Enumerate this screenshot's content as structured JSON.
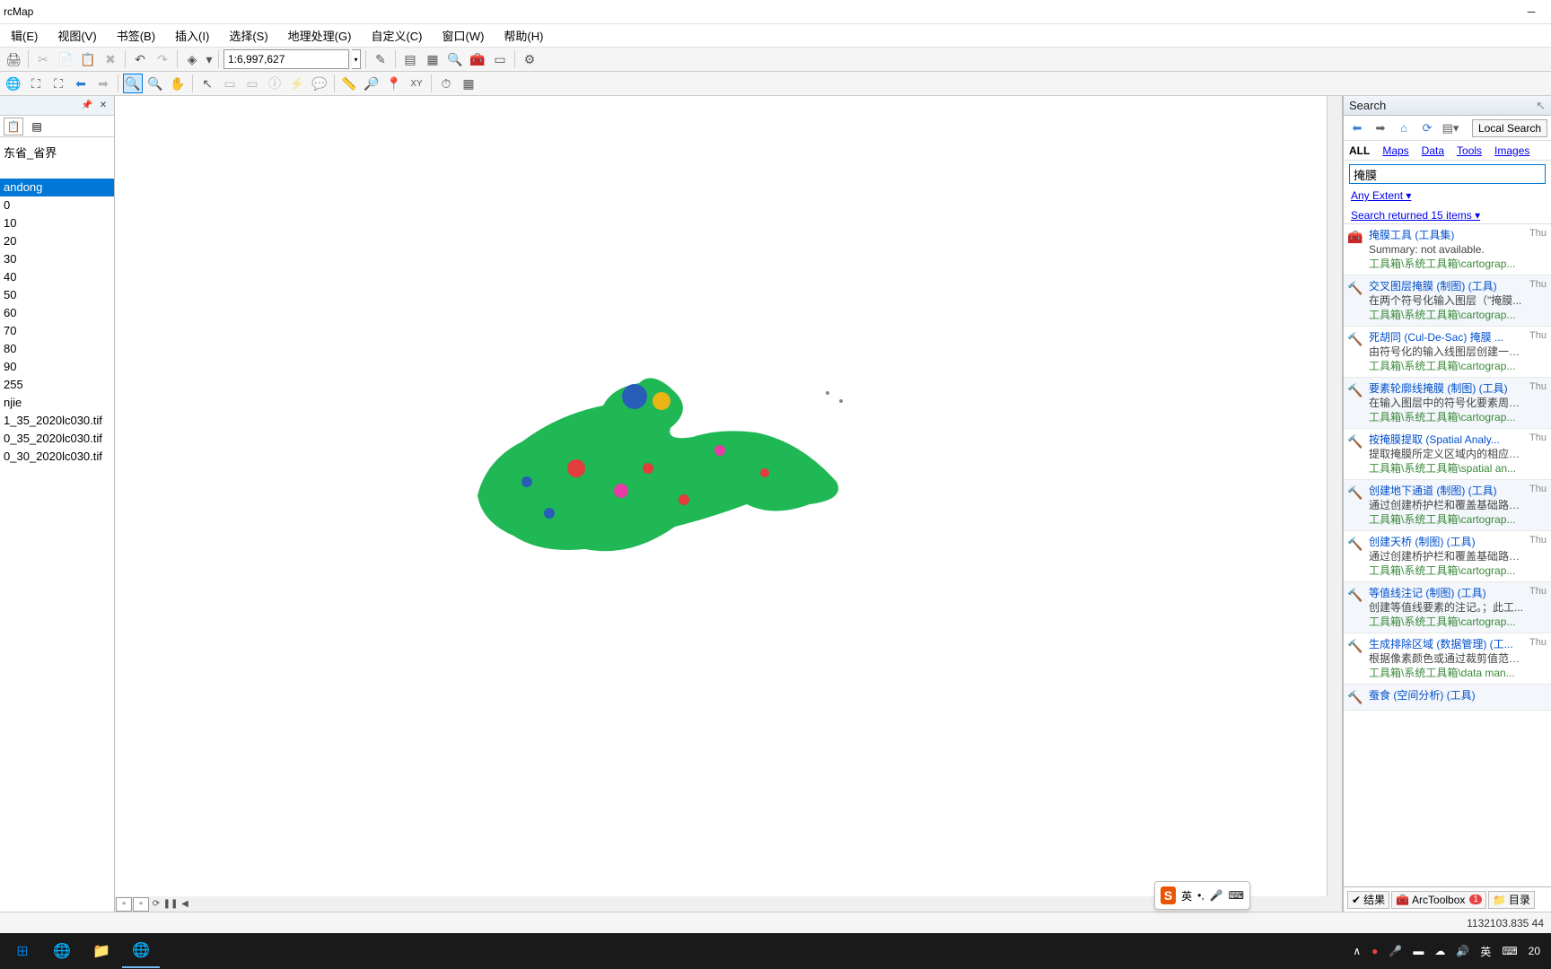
{
  "title": "rcMap",
  "menus": [
    "辑(E)",
    "视图(V)",
    "书签(B)",
    "插入(I)",
    "选择(S)",
    "地理处理(G)",
    "自定义(C)",
    "窗口(W)",
    "帮助(H)"
  ],
  "scale_value": "1:6,997,627",
  "toc": {
    "layer_name": "东省_省界",
    "selected": "andong",
    "values": [
      "0",
      "10",
      "20",
      "30",
      "40",
      "50",
      "60",
      "70",
      "80",
      "90",
      "255"
    ],
    "sublayer": "njie",
    "rasters": [
      "1_35_2020lc030.tif",
      "0_35_2020lc030.tif",
      "0_30_2020lc030.tif"
    ]
  },
  "search": {
    "title": "Search",
    "local_btn": "Local Search",
    "tabs": {
      "all": "ALL",
      "maps": "Maps",
      "data": "Data",
      "tools": "Tools",
      "images": "Images"
    },
    "query": "掩膜",
    "any_extent": "Any Extent ▾",
    "results_header": "Search returned 15 items ▾",
    "results": [
      {
        "icon": "🧰",
        "title": "掩膜工具 (工具集)",
        "desc": "Summary: not available.",
        "path": "工具箱\\系统工具箱\\cartograp...",
        "date": "Thu"
      },
      {
        "icon": "🔨",
        "title": "交叉图层掩膜 (制图) (工具)",
        "desc": "在两个符号化输入图层（\"掩膜...",
        "path": "工具箱\\系统工具箱\\cartograp...",
        "date": "Thu"
      },
      {
        "icon": "🔨",
        "title": "死胡同 (Cul-De-Sac) 掩膜 ...",
        "desc": "由符号化的输入线图层创建一个...",
        "path": "工具箱\\系统工具箱\\cartograp...",
        "date": "Thu"
      },
      {
        "icon": "🔨",
        "title": "要素轮廓线掩膜 (制图) (工具)",
        "desc": "在输入图层中的符号化要素周围...",
        "path": "工具箱\\系统工具箱\\cartograp...",
        "date": "Thu"
      },
      {
        "icon": "🔨",
        "title": "按掩膜提取 (Spatial Analy...",
        "desc": "提取掩膜所定义区域内的相应栅...",
        "path": "工具箱\\系统工具箱\\spatial an...",
        "date": "Thu"
      },
      {
        "icon": "🔨",
        "title": "创建地下通道 (制图) (工具)",
        "desc": "通过创建桥护栏和覆盖基础路段...",
        "path": "工具箱\\系统工具箱\\cartograp...",
        "date": "Thu"
      },
      {
        "icon": "🔨",
        "title": "创建天桥 (制图) (工具)",
        "desc": "通过创建桥护栏和覆盖基础路段...",
        "path": "工具箱\\系统工具箱\\cartograp...",
        "date": "Thu"
      },
      {
        "icon": "🔨",
        "title": "等值线注记 (制图) (工具)",
        "desc": "创建等值线要素的注记。；此工...",
        "path": "工具箱\\系统工具箱\\cartograp...",
        "date": "Thu"
      },
      {
        "icon": "🔨",
        "title": "生成排除区域 (数据管理) (工...",
        "desc": "根据像素颜色或通过裁剪值范围...",
        "path": "工具箱\\系统工具箱\\data man...",
        "date": "Thu"
      },
      {
        "icon": "🔨",
        "title": "蚕食 (空间分析) (工具)",
        "desc": "",
        "path": "",
        "date": ""
      }
    ]
  },
  "bottom_tabs": {
    "results": "结果",
    "toolbox": "ArcToolbox",
    "catalog": "目录",
    "notify": "1"
  },
  "coords": "1132103.835  44",
  "ime": {
    "lang": "英",
    "label": "S"
  },
  "sys_right": "∧  ●  🎤  🔲  ☁  🔊  英  ⌨  20",
  "clock": "20"
}
